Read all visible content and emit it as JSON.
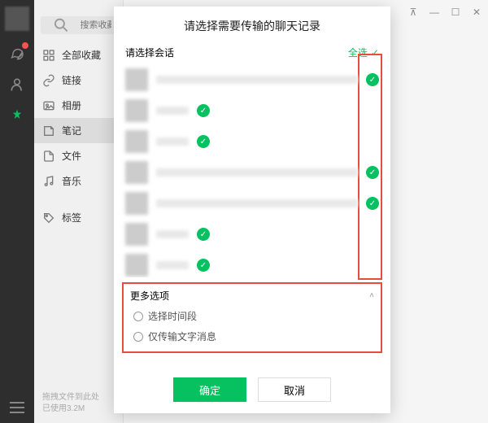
{
  "nav": {
    "items": [
      "chat",
      "contacts",
      "favorites"
    ]
  },
  "sidebar": {
    "search_placeholder": "搜索收藏内容",
    "items": [
      {
        "icon": "grid",
        "label": "全部收藏"
      },
      {
        "icon": "link",
        "label": "链接"
      },
      {
        "icon": "photo",
        "label": "相册"
      },
      {
        "icon": "note",
        "label": "笔记"
      },
      {
        "icon": "file",
        "label": "文件"
      },
      {
        "icon": "music",
        "label": "音乐"
      },
      {
        "icon": "tag",
        "label": "标签"
      }
    ],
    "selected_index": 3,
    "footer_line1": "拖拽文件到此处",
    "footer_line2": "已使用3.2M"
  },
  "bg_window": {
    "pin": "⊼",
    "min": "—",
    "max": "☐",
    "close": "✕"
  },
  "modal": {
    "title": "请选择需要传输的聊天记录",
    "select_conv_label": "请选择会话",
    "select_all_label": "全选",
    "conversations": [
      {
        "checked": true
      },
      {
        "checked": true
      },
      {
        "checked": true
      },
      {
        "checked": true
      },
      {
        "checked": true
      },
      {
        "checked": true
      },
      {
        "checked": true
      }
    ],
    "more_options_label": "更多选项",
    "opt_time_range": "选择时间段",
    "opt_text_only": "仅传输文字消息",
    "confirm": "确定",
    "cancel": "取消"
  },
  "colors": {
    "accent": "#07c160",
    "highlight": "#e74c3c"
  }
}
